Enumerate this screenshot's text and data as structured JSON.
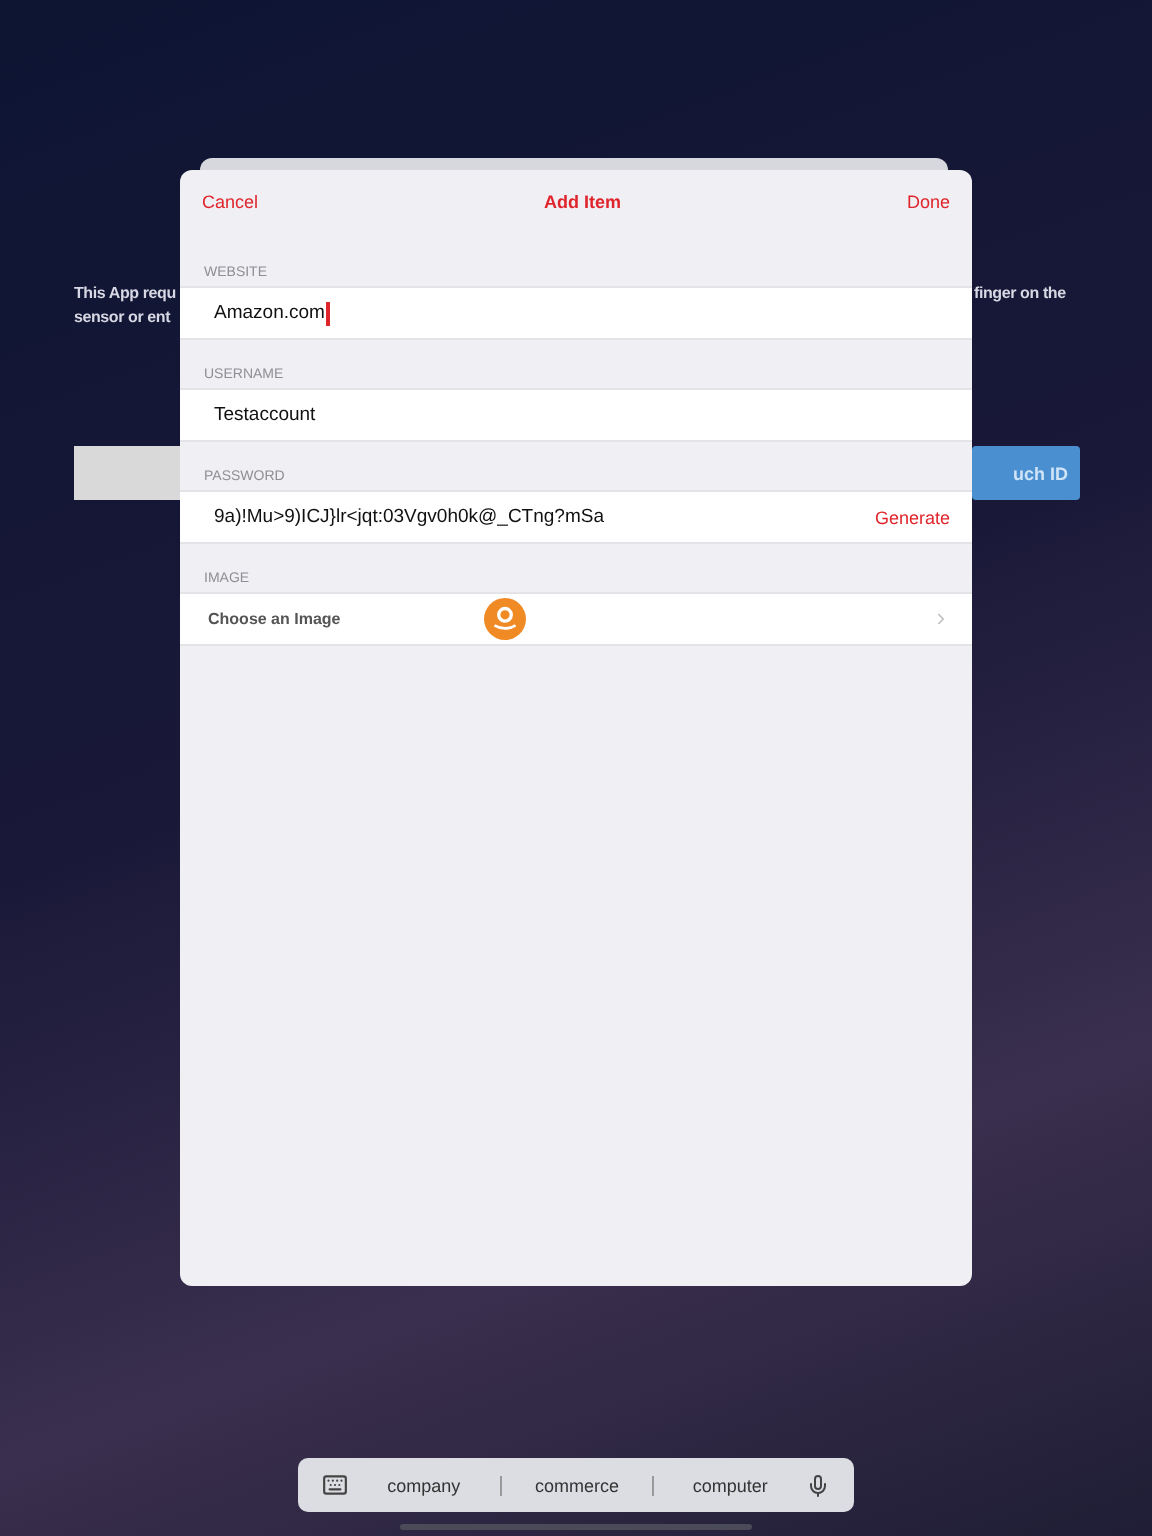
{
  "background": {
    "text_left": [
      "This App requ",
      "sensor or ent"
    ],
    "text_right": [
      "finger on the"
    ],
    "button_right": "uch ID"
  },
  "sheet": {
    "cancel": "Cancel",
    "title": "Add Item",
    "done": "Done",
    "sections": [
      {
        "label": "WEBSITE",
        "kind": "text",
        "value": "Amazon.com",
        "focused": true
      },
      {
        "label": "USERNAME",
        "kind": "text",
        "value": "Testaccount",
        "focused": false
      },
      {
        "label": "PASSWORD",
        "kind": "password",
        "value": "9a)!Mu>9)ICJ}lr<jqt:03Vgv0h0k@_CTng?mSa",
        "action": "Generate"
      },
      {
        "label": "IMAGE",
        "kind": "picker",
        "value": "Choose an Image"
      }
    ]
  },
  "suggestions": [
    "company",
    "commerce",
    "computer"
  ]
}
